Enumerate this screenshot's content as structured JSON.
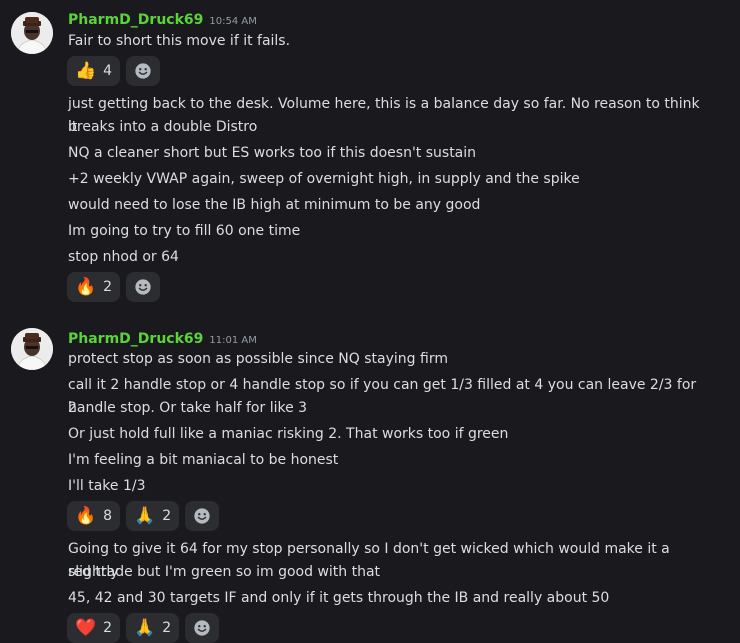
{
  "groups": [
    {
      "username": "PharmD_Druck69",
      "timestamp": "10:54 AM",
      "blocks": [
        {
          "lines": [
            "Fair to short this move if it fails."
          ],
          "reactions": [
            {
              "emoji": "👍",
              "icon": "thumbs-up",
              "count": "4"
            }
          ]
        },
        {
          "lines": [
            "just getting back to the desk. Volume here, this is a balance day so far. No reason to think it",
            "breaks into a double Distro",
            "NQ a cleaner short but ES works too if this doesn't sustain",
            "+2 weekly VWAP again, sweep of overnight high, in supply and the spike",
            "would need to lose the IB high at minimum to be any good",
            "Im going to try to fill 60 one time",
            "stop nhod or 64"
          ],
          "reactions": [
            {
              "emoji": "🔥",
              "icon": "fire",
              "count": "2"
            }
          ]
        }
      ]
    },
    {
      "username": "PharmD_Druck69",
      "timestamp": "11:01 AM",
      "blocks": [
        {
          "lines": [
            "protect stop as soon as possible since NQ staying firm",
            "call it 2 handle stop or 4 handle stop so if you can get 1/3 filled at 4 you can leave 2/3 for 2",
            "handle stop. Or take half for like 3",
            "Or just hold full like a maniac risking 2. That works too if green",
            "I'm feeling a bit maniacal to be honest",
            "I'll take 1/3"
          ],
          "reactions": [
            {
              "emoji": "🔥",
              "icon": "fire",
              "count": "8"
            },
            {
              "emoji": "🙏",
              "icon": "folded-hands",
              "count": "2"
            }
          ]
        },
        {
          "lines": [
            "Going to give it 64 for my stop personally so I don't get wicked which would make it a slightly",
            "red trade but I'm green so im good with that",
            "45, 42 and 30 targets IF and only if it gets through the IB and really about 50"
          ],
          "reactions": [
            {
              "emoji": "❤️",
              "icon": "heart",
              "count": "2"
            },
            {
              "emoji": "🙏",
              "icon": "folded-hands",
              "count": "2"
            }
          ]
        }
      ]
    }
  ],
  "colors": {
    "username": "#5bd33a",
    "background": "#1a1a1e",
    "reaction_bg": "#2b2d31"
  }
}
